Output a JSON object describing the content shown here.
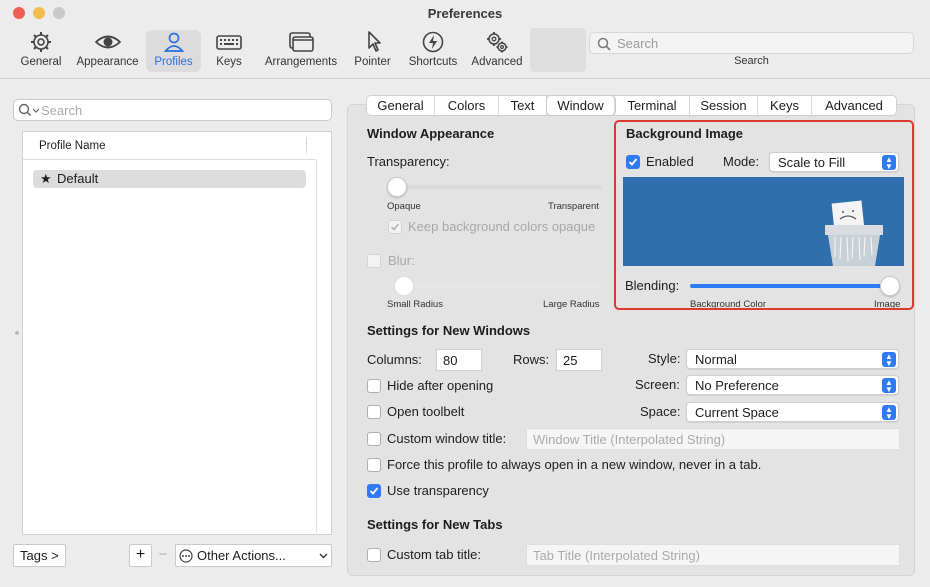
{
  "window": {
    "title": "Preferences"
  },
  "toolbar": {
    "items": [
      {
        "label": "General",
        "icon": "gear-icon"
      },
      {
        "label": "Appearance",
        "icon": "eye-icon"
      },
      {
        "label": "Profiles",
        "icon": "person-icon"
      },
      {
        "label": "Keys",
        "icon": "keyboard-icon"
      },
      {
        "label": "Arrangements",
        "icon": "windows-icon"
      },
      {
        "label": "Pointer",
        "icon": "pointer-icon"
      },
      {
        "label": "Shortcuts",
        "icon": "bolt-icon"
      },
      {
        "label": "Advanced",
        "icon": "gears-icon"
      }
    ],
    "search_placeholder": "Search",
    "search_label": "Search"
  },
  "profiles": {
    "search_placeholder": "Search",
    "column_header": "Profile Name",
    "items": [
      {
        "label": "Default",
        "icon": "star-icon"
      }
    ],
    "tags_button": "Tags >",
    "add_button": "+",
    "remove_button": "−",
    "other_actions": "Other Actions..."
  },
  "tabs": [
    "General",
    "Colors",
    "Text",
    "Window",
    "Terminal",
    "Session",
    "Keys",
    "Advanced"
  ],
  "selected_tab": "Window",
  "window_appearance": {
    "heading": "Window Appearance",
    "transparency_label": "Transparency:",
    "transparency_value": 0,
    "opaque_label": "Opaque",
    "transparent_label": "Transparent",
    "keep_bg_label": "Keep background colors opaque",
    "keep_bg_checked": true,
    "blur_label": "Blur:",
    "blur_checked": false,
    "small_radius": "Small Radius",
    "large_radius": "Large Radius"
  },
  "background_image": {
    "heading": "Background Image",
    "enabled_label": "Enabled",
    "enabled_checked": true,
    "mode_label": "Mode:",
    "mode_value": "Scale to Fill",
    "blending_label": "Blending:",
    "blending_value": 1,
    "bg_color_label": "Background Color",
    "image_label": "Image",
    "highlight_color": "#e03a2f"
  },
  "new_windows": {
    "heading": "Settings for New Windows",
    "columns_label": "Columns:",
    "columns_value": "80",
    "rows_label": "Rows:",
    "rows_value": "25",
    "style_label": "Style:",
    "style_value": "Normal",
    "screen_label": "Screen:",
    "screen_value": "No Preference",
    "space_label": "Space:",
    "space_value": "Current Space",
    "hide_label": "Hide after opening",
    "toolbelt_label": "Open toolbelt",
    "custom_title_label": "Custom window title:",
    "custom_title_placeholder": "Window Title (Interpolated String)",
    "force_label": "Force this profile to always open in a new window, never in a tab.",
    "use_transparency_label": "Use transparency",
    "use_transparency_checked": true
  },
  "new_tabs": {
    "heading": "Settings for New Tabs",
    "custom_tab_label": "Custom tab title:",
    "custom_tab_placeholder": "Tab Title (Interpolated String)"
  },
  "colors": {
    "accent": "#2f7bf5",
    "traffic_red": "#ee5f56",
    "traffic_yellow": "#f5bd4f",
    "traffic_green": "#c8c8c8"
  }
}
